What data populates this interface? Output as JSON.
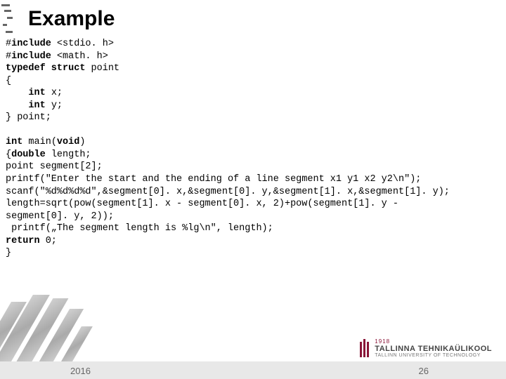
{
  "title": "Example",
  "code": {
    "l1a": "#",
    "l1b": "include",
    "l1c": " <stdio. h>",
    "l2a": "#",
    "l2b": "include",
    "l2c": " <math. h>",
    "l3a": "typedef struct",
    "l3b": " point",
    "l4": "{",
    "l5a": "    ",
    "l5b": "int",
    "l5c": " x;",
    "l6a": "    ",
    "l6b": "int",
    "l6c": " y;",
    "l7": "} point;",
    "m1a": "int",
    "m1b": " main(",
    "m1c": "void",
    "m1d": ")",
    "m2a": "{",
    "m2b": "double",
    "m2c": " length;",
    "m3": "point segment[2];",
    "m4": "printf(\"Enter the start and the ending of a line segment x1 y1 x2 y2\\n\");",
    "m5": "scanf(\"%d%d%d%d\",&segment[0]. x,&segment[0]. y,&segment[1]. x,&segment[1]. y);",
    "m6": "length=sqrt(pow(segment[1]. x - segment[0]. x, 2)+pow(segment[1]. y -",
    "m6b": "segment[0]. y, 2));",
    "m7": " printf(„The segment length is %lg\\n\", length);",
    "m8a": "return",
    "m8b": " 0;",
    "m9": "}"
  },
  "footer": {
    "year": "2016",
    "page": "26"
  },
  "logo": {
    "year": "1918",
    "line1": "TALLINNA TEHNIKAÜLIKOOL",
    "line2": "TALLINN UNIVERSITY OF TECHNOLOGY"
  }
}
